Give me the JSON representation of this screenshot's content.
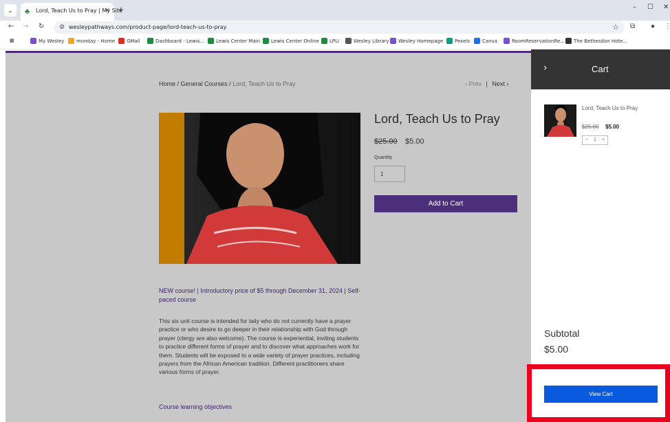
{
  "browser": {
    "tab_title": "Lord, Teach Us to Pray | My Site",
    "tab_close": "✕",
    "new_tab": "+",
    "url": "wesleypathways.com/product-page/lord-teach-us-to-pray",
    "bookmarks": [
      {
        "label": "My Wesley",
        "color": "#7a4fd0"
      },
      {
        "label": "monday - Home",
        "color": "#f5a623"
      },
      {
        "label": "GMail",
        "color": "#d93025"
      },
      {
        "label": "Dashboard - Lewis...",
        "color": "#1e8e3e"
      },
      {
        "label": "Lewis Center Main",
        "color": "#1e8e3e"
      },
      {
        "label": "Lewis Center Online",
        "color": "#1e8e3e"
      },
      {
        "label": "LPLI",
        "color": "#1e8e3e"
      },
      {
        "label": "Wesley Library",
        "color": "#555555"
      },
      {
        "label": "Wesley Homepage",
        "color": "#7a4fd0"
      },
      {
        "label": "Pexels",
        "color": "#05a081"
      },
      {
        "label": "Canva",
        "color": "#1a73e8"
      },
      {
        "label": "RoomReservationRe...",
        "color": "#7a4fd0"
      },
      {
        "label": "The Bethesdan Hote...",
        "color": "#333333"
      }
    ]
  },
  "page": {
    "breadcrumb": {
      "home": "Home",
      "sep1": " / ",
      "category": "General Courses",
      "sep2": " / ",
      "current": "Lord, Teach Us to Pray"
    },
    "prev": "Prev",
    "next": "Next",
    "product": {
      "title": "Lord, Teach Us to Pray",
      "price_old": "$25.00",
      "price_new": "$5.00",
      "quantity_label": "Quantity",
      "quantity_value": "1",
      "add_to_cart": "Add to Cart"
    },
    "promo": "NEW course! | Introductory price of $5 through December 31, 2024 | Self-paced course",
    "description": "This six unit course is intended for laity who do not currently have a prayer practice or who desire to go deeper in their relationship with God through prayer (clergy are also welcome). The course is experiential, inviting students to practice different forms of prayer and to discover what approaches work for them. Students will be exposed to a wide variety of prayer practices, including prayers from the African American tradition. Different practitioners share various forms of prayer.",
    "objectives_heading": "Course learning objectives"
  },
  "cart": {
    "title": "Cart",
    "item_name": "Lord, Teach Us to Pray",
    "item_price_old": "$25.00",
    "item_price_new": "$5.00",
    "item_qty": "1",
    "subtotal_label": "Subtotal",
    "subtotal_value": "$5.00",
    "view_cart": "View Cart"
  },
  "colors": {
    "brand_purple": "#4c2f7a",
    "view_cart_blue": "#0a5ae0",
    "highlight_red": "#e8001e"
  }
}
